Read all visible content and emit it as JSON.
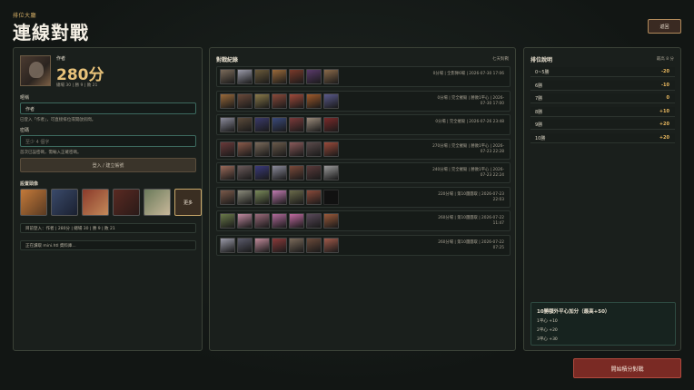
{
  "header": {
    "eyebrow": "排位大廳",
    "title": "連線對戰",
    "back_label": "返回"
  },
  "profile": {
    "name": "作者",
    "score": "280分",
    "stats": "總場 30 | 勝 9 | 敗 21",
    "nickname_label": "暱稱",
    "nickname_value": "作者",
    "nickname_hint": "已登入「作者」，可直接排位或開啟房間。",
    "password_label": "密碼",
    "password_placeholder": "至少 4 個字",
    "password_hint": "首次已設密碼，需輸入正確密碼。",
    "join_button": "登入 / 建立帳號",
    "avatar_section_label": "設置頭像",
    "more_button": "更多",
    "status_line": "目前登入：作者 | 280分 | 總場 30 | 勝 9 | 敗 21",
    "sync_line": "正在讀取 mini.htl 資料庫..."
  },
  "avatars": [
    {
      "name": "avatar-option-1",
      "c1": "#c47a3a",
      "c2": "#5a3a22"
    },
    {
      "name": "avatar-option-2",
      "c1": "#3a4a6a",
      "c2": "#1a2030"
    },
    {
      "name": "avatar-option-3",
      "c1": "#8a3a2a",
      "c2": "#c48a5a"
    },
    {
      "name": "avatar-option-4",
      "c1": "#5a2a22",
      "c2": "#2a1a18"
    },
    {
      "name": "avatar-option-5",
      "c1": "#6a7a5a",
      "c2": "#c8b89a"
    }
  ],
  "records": {
    "title": "對戰紀錄",
    "subtitle": "七天對戰",
    "matches": [
      {
        "info": "0分場 | 全影隊6場 | 2026-07-30 17:06",
        "heroes": [
          "#7a6a5a",
          "#9a9aa8",
          "#6a5a3a",
          "#9a6a3a",
          "#7a3a2a",
          "#5a3a6a",
          "#8a6a4a"
        ]
      },
      {
        "info": "0分場 | 完全摧毀 | 勝敗1平心 | 2026-07-30 17:00",
        "heroes": [
          "#9a6a3a",
          "#6a4a3a",
          "#8a7a4a",
          "#8a4a3a",
          "#a04a3a",
          "#a05a2a",
          "#5a5a8a"
        ]
      },
      {
        "info": "0分場 | 完全摧毀 | 2026-07-26 23:48",
        "heroes": [
          "#8a8a9a",
          "#5a4a3a",
          "#3a3a6a",
          "#3a4a7a",
          "#7a3a3a",
          "#9a8a7a",
          "#7a2a2a"
        ]
      },
      {
        "info": "270分場 | 完全摧毀 | 勝敗1平心 | 2026-07-23 22:28",
        "heroes": [
          "#6a3a3a",
          "#8a5a4a",
          "#7a6a5a",
          "#6a5a4a",
          "#8a5a5a",
          "#5a4a4a",
          "#9a4a3a"
        ]
      },
      {
        "info": "240分場 | 完全摧毀 | 勝敗1平心 | 2026-07-23 22:24",
        "heroes": [
          "#9a6a5a",
          "#6a5a5a",
          "#3a3a7a",
          "#8a8a9a",
          "#7a4a3a",
          "#5a3a3a",
          "#9a9a9a"
        ]
      },
      {
        "info": "220分場 | 第10團團取 | 2026-07-23 22:03",
        "heroes": [
          "#7a5a4a",
          "#8a8a7a",
          "#7a8a5a",
          "#c07ab0",
          "#6a6a4a",
          "#8a4a3a",
          ""
        ]
      },
      {
        "info": "260分場 | 第10團團取 | 2026-07-22 11:47",
        "heroes": [
          "#6a7a4a",
          "#c08aa0",
          "#9a6a7a",
          "#b06a9a",
          "#c06aa0",
          "#5a4a5a",
          "#9a5a3a"
        ]
      },
      {
        "info": "260分場 | 第10團團取 | 2026-07-22 07:25",
        "heroes": [
          "#9a9aa8",
          "#5a5a6a",
          "#c08a9a",
          "#8a3a3a",
          "#7a6a5a",
          "#6a4a3a",
          "#a05a4a"
        ]
      }
    ]
  },
  "ranking": {
    "title": "排位說明",
    "subtitle": "最高 8 分",
    "rows": [
      {
        "label": "0~5勝",
        "value": "-20"
      },
      {
        "label": "6勝",
        "value": "-10"
      },
      {
        "label": "7勝",
        "value": "0"
      },
      {
        "label": "8勝",
        "value": "+10"
      },
      {
        "label": "9勝",
        "value": "+20"
      },
      {
        "label": "10勝",
        "value": "+20"
      }
    ],
    "bonus": {
      "title": "10勝額外平心加分（最高+50）",
      "lines": [
        "1平心 +10",
        "2平心 +20",
        "3平心 +30"
      ]
    }
  },
  "start_button": "開始積分對戰"
}
